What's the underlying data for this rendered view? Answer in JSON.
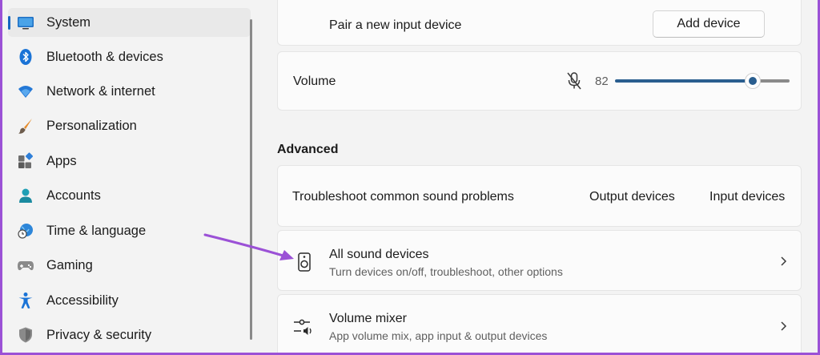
{
  "sidebar": {
    "items": [
      {
        "label": "System",
        "icon": "system-monitor-icon",
        "active": true
      },
      {
        "label": "Bluetooth & devices",
        "icon": "bluetooth-icon"
      },
      {
        "label": "Network & internet",
        "icon": "wifi-icon"
      },
      {
        "label": "Personalization",
        "icon": "brush-icon"
      },
      {
        "label": "Apps",
        "icon": "apps-icon"
      },
      {
        "label": "Accounts",
        "icon": "person-icon"
      },
      {
        "label": "Time & language",
        "icon": "globe-clock-icon"
      },
      {
        "label": "Gaming",
        "icon": "gamepad-icon"
      },
      {
        "label": "Accessibility",
        "icon": "accessibility-icon"
      },
      {
        "label": "Privacy & security",
        "icon": "shield-icon"
      }
    ]
  },
  "input": {
    "pair_label": "Pair a new input device",
    "add_button": "Add device",
    "volume_label": "Volume",
    "volume_value": "82",
    "volume_level": 0.82,
    "mute_icon": "microphone-muted-icon"
  },
  "advanced": {
    "title": "Advanced",
    "troubleshoot": {
      "label": "Troubleshoot common sound problems",
      "output_link": "Output devices",
      "input_link": "Input devices"
    },
    "all_sound_devices": {
      "title": "All sound devices",
      "subtitle": "Turn devices on/off, troubleshoot, other options",
      "icon": "speaker-icon"
    },
    "volume_mixer": {
      "title": "Volume mixer",
      "subtitle": "App volume mix, app input & output devices",
      "icon": "mixer-sliders-icon"
    }
  },
  "colors": {
    "accent": "#2a5e8f",
    "annotation_arrow": "#9b51d6",
    "background_frame": "#9b51d6"
  }
}
